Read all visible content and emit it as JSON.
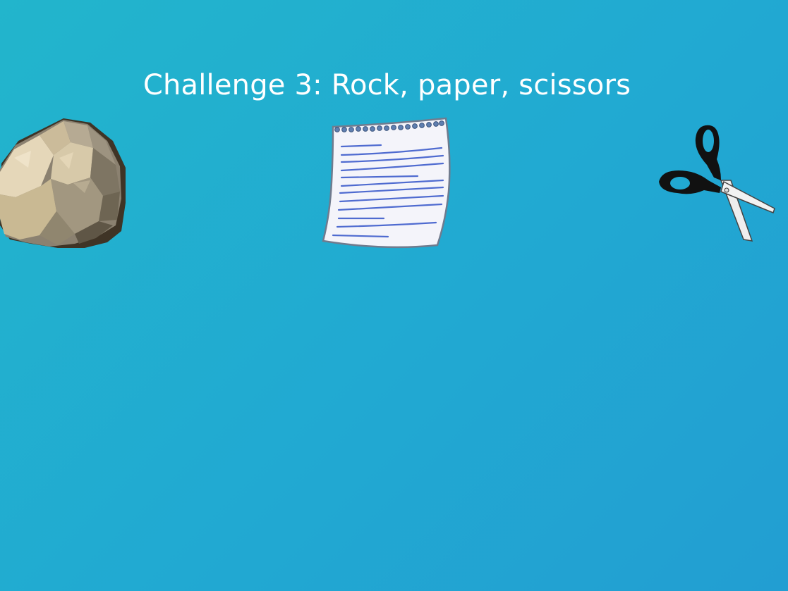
{
  "slide": {
    "title": "Challenge 3: Rock, paper, scissors",
    "background_colors": [
      "#22b5cc",
      "#21a9d2",
      "#229ed2"
    ],
    "title_color": "#ffffff"
  },
  "images": [
    {
      "name": "rock-image",
      "icon": "rock-icon"
    },
    {
      "name": "paper-image",
      "icon": "paper-icon"
    },
    {
      "name": "scissors-image",
      "icon": "scissors-icon"
    }
  ]
}
